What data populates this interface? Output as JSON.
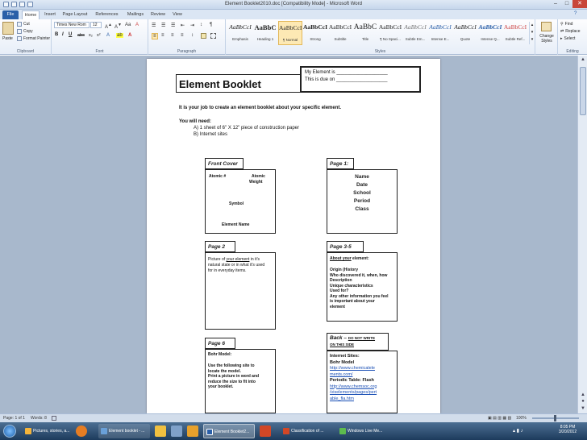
{
  "window": {
    "title": "Element Booklet2010.doc [Compatibility Mode] - Microsoft Word"
  },
  "tabs": [
    "File",
    "Home",
    "Insert",
    "Page Layout",
    "References",
    "Mailings",
    "Review",
    "View"
  ],
  "clipboard": {
    "paste": "Paste",
    "cut": "Cut",
    "copy": "Copy",
    "format_painter": "Format Painter",
    "label": "Clipboard"
  },
  "font": {
    "name": "Times New Rom",
    "size": "12",
    "label": "Font"
  },
  "paragraph": {
    "label": "Paragraph"
  },
  "styles": {
    "label": "Styles",
    "items": [
      {
        "sample": "AaBbCcI",
        "name": "Emphasis"
      },
      {
        "sample": "AaBbC",
        "name": "Heading 1"
      },
      {
        "sample": "AaBbCcI",
        "name": "¶ Normal"
      },
      {
        "sample": "AaBbCcI",
        "name": "Strong"
      },
      {
        "sample": "AaBbCcI",
        "name": "Subtitle"
      },
      {
        "sample": "AaBbC",
        "name": "Title"
      },
      {
        "sample": "AaBbCcI",
        "name": "¶ No Spaci..."
      },
      {
        "sample": "AaBbCcI",
        "name": "Subtle Em..."
      },
      {
        "sample": "AaBbCcI",
        "name": "Intense E..."
      },
      {
        "sample": "AaBbCcI",
        "name": "Quote"
      },
      {
        "sample": "AaBbCcI",
        "name": "Intense Q..."
      },
      {
        "sample": "AaBbCcI",
        "name": "Subtle Ref..."
      }
    ],
    "change": "Change Styles"
  },
  "editing": {
    "find": "Find",
    "replace": "Replace",
    "select": "Select",
    "label": "Editing"
  },
  "doc": {
    "title": "Element Booklet",
    "element_line": "My Element is ___________________",
    "due_line": "This is due on ___________________",
    "intro": "It is your job to create an element booklet about your specific element.",
    "you_will_need": "You will need:",
    "need_a": "A)  1 sheet of 6\" X 12\" piece of construction paper",
    "need_b": "B)  Internet sites",
    "front_cover": {
      "header": "Front Cover",
      "atomic_num": "Atomic #",
      "atomic_weight_1": "Atomic",
      "atomic_weight_2": "Weight",
      "symbol": "Symbol",
      "element_name": "Element  Name"
    },
    "page1": {
      "header": "Page 1:",
      "lines": [
        "Name",
        "Date",
        "School",
        "Period",
        "Class"
      ]
    },
    "page2": {
      "header": "Page 2",
      "line1_pre": "Picture of ",
      "line1_link": "your  element",
      "line1_post": " in it's",
      "line2": "natural state or in what it's used",
      "line3": "for in everyday items."
    },
    "page35": {
      "header": "Page 3-5",
      "about_link": "About  your",
      "about_post": " element:",
      "lines": [
        "Origin (History",
        "Who discovered it, when, how",
        "Description",
        "Unique characteristics",
        "Used for?",
        "Any other information you feel",
        "is important about your",
        "element"
      ]
    },
    "page6": {
      "header": "Page 6",
      "bohr": "Bohr Model:",
      "lines": [
        "Use the following  site to",
        "locate the model.",
        "Print a picture in word and",
        "reduce the size to fit into",
        "your booklet."
      ]
    },
    "back": {
      "header_1": "Back –",
      "header_2": "DO NOT WRITE",
      "header_3": "ON THIS SIDE",
      "sites": "Internet Sites:",
      "bohr": "Bohr Model",
      "bohr_url_1": "http://www.chemicalele",
      "bohr_url_2": "ments.com/",
      "periodic": "Periodic Table: Flash",
      "periodic_url_1": "http://www.chemsoc.org",
      "periodic_url_2": "/viselements/pages/pert",
      "periodic_url_3": "able_fla.htm"
    }
  },
  "status": {
    "page": "Page: 1 of 1",
    "words": "Words: 8",
    "zoom": "100%"
  },
  "taskbar": {
    "items": [
      "Pictures, stories, a...",
      "Element booklet - ...",
      "Element Booklet2...",
      "Classification of ...",
      "Windows Live Me..."
    ],
    "time": "8:05 PM",
    "date": "3/20/2012"
  }
}
